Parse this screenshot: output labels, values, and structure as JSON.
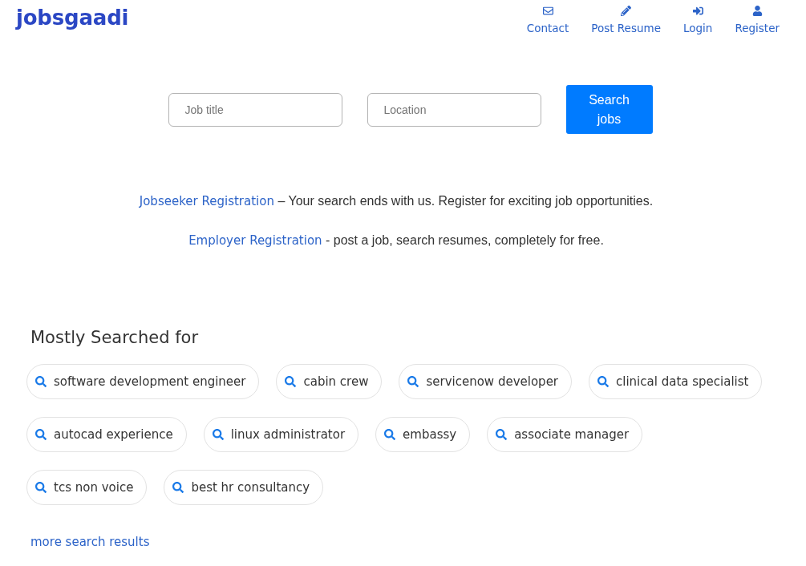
{
  "header": {
    "logo": "jobsgaadi",
    "nav": [
      {
        "label": "Contact"
      },
      {
        "label": "Post Resume"
      },
      {
        "label": "Login"
      },
      {
        "label": "Register"
      }
    ]
  },
  "search": {
    "job_title": {
      "placeholder": "Job title"
    },
    "location": {
      "placeholder": "Location"
    },
    "button": "Search jobs"
  },
  "registration": [
    {
      "link": "Jobseeker Registration",
      "text": "– Your search ends with us. Register for exciting job opportunities."
    },
    {
      "link": "Employer Registration",
      "text": "- post a job, search resumes, completely for free."
    }
  ],
  "popular": {
    "title": "Mostly Searched for",
    "tags": [
      "software development engineer",
      "cabin crew",
      "servicenow developer",
      "clinical data specialist",
      "autocad experience",
      "linux administrator",
      "embassy",
      "associate manager",
      "tcs non voice",
      "best hr consultancy"
    ],
    "more_link": "more search results"
  }
}
